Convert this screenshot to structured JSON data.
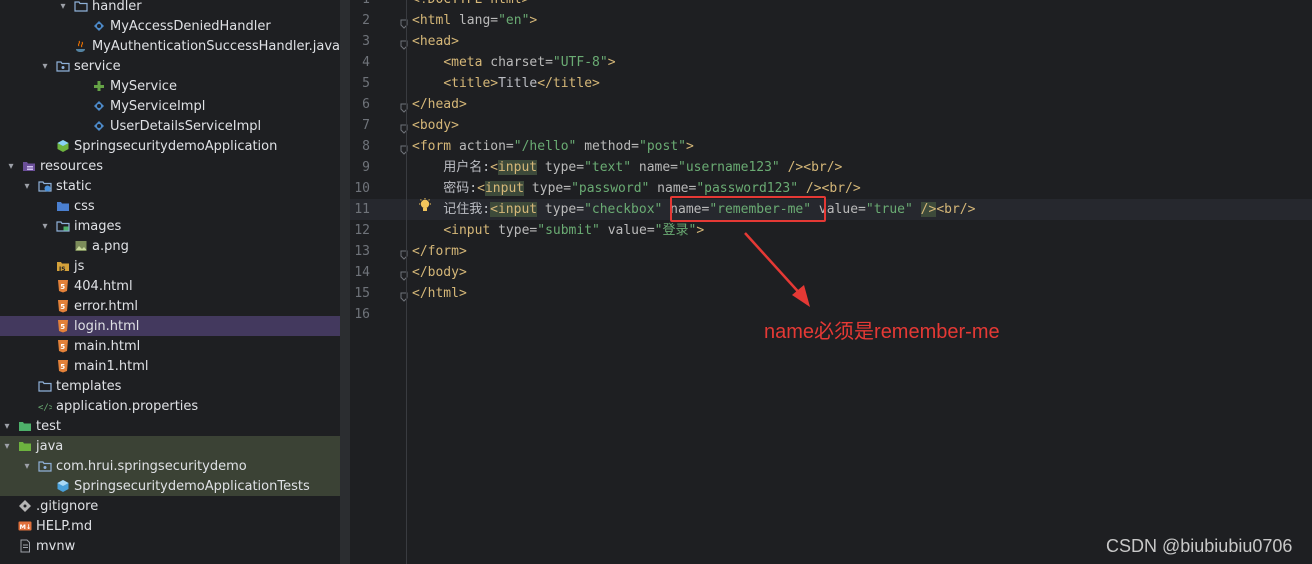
{
  "project_tree": [
    {
      "label": "handler",
      "chev": "open",
      "icon": "folder-icon"
    },
    {
      "label": "MyAccessDeniedHandler",
      "chev": "none",
      "icon": "class-icon"
    },
    {
      "label": "MyAuthenticationSuccessHandler.java",
      "chev": "none",
      "icon": "java-file-icon"
    },
    {
      "label": "service",
      "chev": "open",
      "icon": "package-icon"
    },
    {
      "label": "MyService",
      "chev": "none",
      "icon": "interface-icon"
    },
    {
      "label": "MyServiceImpl",
      "chev": "none",
      "icon": "class-icon"
    },
    {
      "label": "UserDetailsServiceImpl",
      "chev": "none",
      "icon": "class-icon"
    },
    {
      "label": "SpringsecuritydemoApplication",
      "chev": "none",
      "icon": "spring-boot-icon"
    },
    {
      "label": "resources",
      "chev": "open",
      "icon": "resources-folder-icon"
    },
    {
      "label": "static",
      "chev": "open",
      "icon": "web-folder-icon"
    },
    {
      "label": "css",
      "chev": "none",
      "icon": "css-folder-icon"
    },
    {
      "label": "images",
      "chev": "open",
      "icon": "images-folder-icon"
    },
    {
      "label": "a.png",
      "chev": "none",
      "icon": "image-file-icon"
    },
    {
      "label": "js",
      "chev": "none",
      "icon": "js-folder-icon"
    },
    {
      "label": "404.html",
      "chev": "none",
      "icon": "html-file-icon"
    },
    {
      "label": "error.html",
      "chev": "none",
      "icon": "html-file-icon"
    },
    {
      "label": "login.html",
      "chev": "none",
      "icon": "html-file-icon",
      "selected": true
    },
    {
      "label": "main.html",
      "chev": "none",
      "icon": "html-file-icon"
    },
    {
      "label": "main1.html",
      "chev": "none",
      "icon": "html-file-icon"
    },
    {
      "label": "templates",
      "chev": "none",
      "icon": "folder-icon"
    },
    {
      "label": "application.properties",
      "chev": "none",
      "icon": "properties-file-icon"
    },
    {
      "label": "test",
      "chev": "open",
      "icon": "test-folder-icon"
    },
    {
      "label": "java",
      "chev": "open",
      "icon": "test-source-folder-icon",
      "test_area": true
    },
    {
      "label": "com.hrui.springsecuritydemo",
      "chev": "open",
      "icon": "package-icon",
      "test_area": true
    },
    {
      "label": "SpringsecuritydemoApplicationTests",
      "chev": "none",
      "icon": "test-class-icon",
      "test_area": true
    },
    {
      "label": ".gitignore",
      "chev": "none",
      "icon": "gitignore-icon"
    },
    {
      "label": "HELP.md",
      "chev": "none",
      "icon": "markdown-icon"
    },
    {
      "label": "mvnw",
      "chev": "none",
      "icon": "text-file-icon"
    }
  ],
  "editor": {
    "lines": [
      {
        "n": "1",
        "tokens": [
          [
            "t",
            "<!DOCTYPE html>"
          ]
        ]
      },
      {
        "n": "2",
        "tokens": [
          [
            "t",
            "<html "
          ],
          [
            "a",
            "lang="
          ],
          [
            "s",
            "\"en\""
          ],
          [
            "t",
            ">"
          ]
        ]
      },
      {
        "n": "3",
        "tokens": [
          [
            "t",
            "<head>"
          ]
        ]
      },
      {
        "n": "4",
        "tokens": [
          [
            "p",
            "    "
          ],
          [
            "t",
            "<meta "
          ],
          [
            "a",
            "charset="
          ],
          [
            "s",
            "\"UTF-8\""
          ],
          [
            "t",
            ">"
          ]
        ]
      },
      {
        "n": "5",
        "tokens": [
          [
            "p",
            "    "
          ],
          [
            "t",
            "<title>"
          ],
          [
            "p",
            "Title"
          ],
          [
            "t",
            "</title>"
          ]
        ]
      },
      {
        "n": "6",
        "tokens": [
          [
            "t",
            "</head>"
          ]
        ]
      },
      {
        "n": "7",
        "tokens": [
          [
            "t",
            "<body>"
          ]
        ]
      },
      {
        "n": "8",
        "tokens": [
          [
            "t",
            "<form "
          ],
          [
            "a",
            "action="
          ],
          [
            "s",
            "\"/hello\""
          ],
          [
            "a",
            " method="
          ],
          [
            "s",
            "\"post\""
          ],
          [
            "t",
            ">"
          ]
        ]
      },
      {
        "n": "9",
        "tokens": [
          [
            "p",
            "    用户名:"
          ],
          [
            "t",
            "<"
          ],
          [
            "th",
            "input"
          ],
          [
            "a",
            " type="
          ],
          [
            "s",
            "\"text\""
          ],
          [
            "a",
            " name="
          ],
          [
            "s",
            "\"username123\""
          ],
          [
            "t",
            " /><br/>"
          ]
        ]
      },
      {
        "n": "10",
        "tokens": [
          [
            "p",
            "    密码:"
          ],
          [
            "t",
            "<"
          ],
          [
            "th",
            "input"
          ],
          [
            "a",
            " type="
          ],
          [
            "s",
            "\"password\""
          ],
          [
            "a",
            " name="
          ],
          [
            "s",
            "\"password123\""
          ],
          [
            "t",
            " /><br/>"
          ]
        ]
      },
      {
        "n": "11",
        "tokens": [
          [
            "p",
            "    记住我:"
          ],
          [
            "th",
            "<input"
          ],
          [
            "a",
            " type="
          ],
          [
            "s",
            "\"checkbox\""
          ],
          [
            "a",
            " name="
          ],
          [
            "s",
            "\"remember-me\""
          ],
          [
            "a",
            " value="
          ],
          [
            "s",
            "\"true\""
          ],
          [
            "p",
            " "
          ],
          [
            "th",
            "/>"
          ],
          [
            "t",
            "<br/>"
          ]
        ]
      },
      {
        "n": "12",
        "tokens": [
          [
            "p",
            "    "
          ],
          [
            "t",
            "<input "
          ],
          [
            "a",
            "type="
          ],
          [
            "s",
            "\"submit\""
          ],
          [
            "a",
            " value="
          ],
          [
            "s",
            "\"登录\""
          ],
          [
            "t",
            ">"
          ]
        ]
      },
      {
        "n": "13",
        "tokens": [
          [
            "t",
            "</form>"
          ]
        ]
      },
      {
        "n": "14",
        "tokens": [
          [
            "t",
            "</body>"
          ]
        ]
      },
      {
        "n": "15",
        "tokens": [
          [
            "t",
            "</html>"
          ]
        ]
      },
      {
        "n": "16",
        "tokens": []
      }
    ],
    "current_line": "11"
  },
  "annotation": {
    "text": "name必须是remember-me",
    "color": "#e53935"
  },
  "watermark": "CSDN @biubiubiu0706",
  "colors": {
    "background": "#1e1f22",
    "selection": "#43395e",
    "tag": "#d5b778",
    "string": "#6aab73",
    "attribute": "#bababa",
    "annotation_red": "#e53935"
  }
}
